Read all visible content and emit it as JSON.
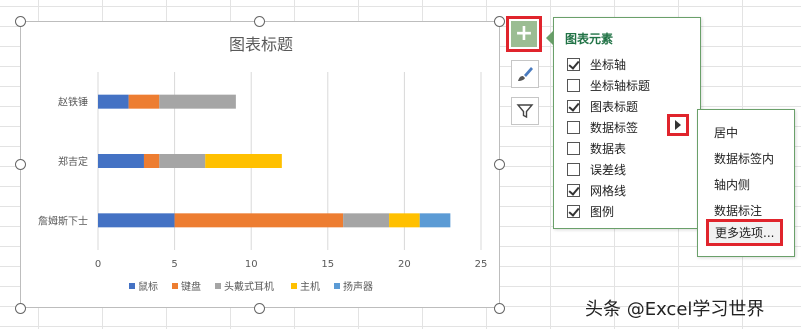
{
  "chart_data": {
    "type": "bar",
    "orientation": "horizontal",
    "stacked": true,
    "title": "图表标题",
    "categories": [
      "赵铁锤",
      "郑吉定",
      "詹姆斯下士"
    ],
    "series": [
      {
        "name": "鼠标",
        "color": "#4472c4",
        "values": [
          2,
          3,
          5
        ]
      },
      {
        "name": "键盘",
        "color": "#ed7d31",
        "values": [
          2,
          1,
          11
        ]
      },
      {
        "name": "头戴式耳机",
        "color": "#a5a5a5",
        "values": [
          5,
          3,
          3
        ]
      },
      {
        "name": "主机",
        "color": "#ffc000",
        "values": [
          0,
          5,
          2
        ]
      },
      {
        "name": "扬声器",
        "color": "#5b9bd5",
        "values": [
          0,
          0,
          2
        ]
      }
    ],
    "xticks": [
      "0",
      "5",
      "10",
      "15",
      "20",
      "25"
    ],
    "xlim": [
      0,
      25
    ],
    "grid": true,
    "legend_position": "bottom"
  },
  "chart_elements_panel": {
    "title": "图表元素",
    "items": [
      {
        "label": "坐标轴",
        "checked": true
      },
      {
        "label": "坐标轴标题",
        "checked": false
      },
      {
        "label": "图表标题",
        "checked": true
      },
      {
        "label": "数据标签",
        "checked": false
      },
      {
        "label": "数据表",
        "checked": false
      },
      {
        "label": "误差线",
        "checked": false
      },
      {
        "label": "网格线",
        "checked": true
      },
      {
        "label": "图例",
        "checked": true
      }
    ]
  },
  "data_label_submenu": {
    "items": [
      "居中",
      "数据标签内",
      "轴内侧",
      "数据标注"
    ],
    "more_options": "更多选项..."
  },
  "side_buttons": [
    "plus-icon",
    "brush-icon",
    "filter-icon"
  ],
  "watermark": "头条 @Excel学习世界",
  "colors": {
    "accent": "#217346",
    "highlight": "#e0242c",
    "plus_button": "#9bbd93"
  }
}
